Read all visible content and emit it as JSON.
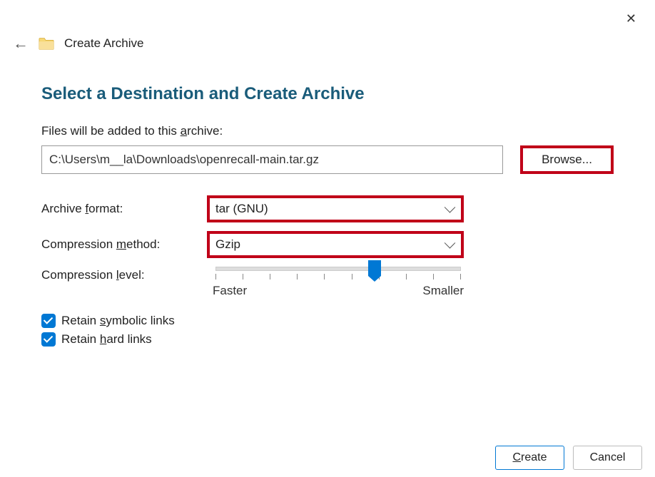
{
  "window": {
    "title": "Create Archive"
  },
  "heading": "Select a Destination and Create Archive",
  "labels": {
    "files_added_pre": "Files will be added to this ",
    "files_added_ul": "a",
    "files_added_post": "rchive:",
    "archive_format_pre": "Archive ",
    "archive_format_ul": "f",
    "archive_format_post": "ormat:",
    "compression_method_pre": "Compression ",
    "compression_method_ul": "m",
    "compression_method_post": "ethod:",
    "compression_level_pre": "Compression ",
    "compression_level_ul": "l",
    "compression_level_post": "evel:"
  },
  "path_value": "C:\\Users\\m__la\\Downloads\\openrecall-main.tar.gz",
  "browse_label": "Browse...",
  "archive_format_value": "tar (GNU)",
  "compression_method_value": "Gzip",
  "slider": {
    "faster_label": "Faster",
    "smaller_label": "Smaller",
    "position_pct": 65
  },
  "checks": {
    "symbolic_pre": "Retain ",
    "symbolic_ul": "s",
    "symbolic_post": "ymbolic links",
    "symbolic_checked": true,
    "hard_pre": "Retain ",
    "hard_ul": "h",
    "hard_post": "ard links",
    "hard_checked": true
  },
  "footer": {
    "create_ul": "C",
    "create_post": "reate",
    "cancel": "Cancel"
  }
}
